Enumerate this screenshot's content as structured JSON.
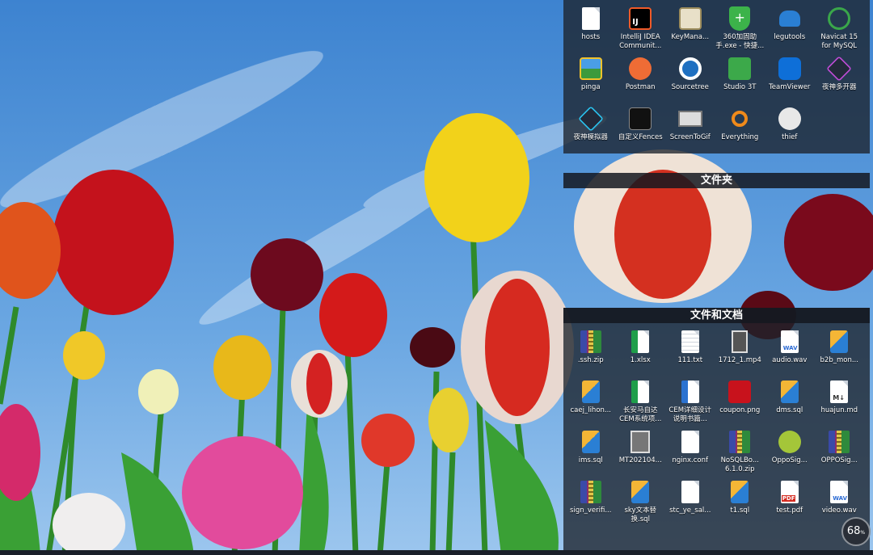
{
  "fences": {
    "apps": {
      "items": [
        {
          "label": "hosts",
          "icon": "file-shortcut-icon"
        },
        {
          "label": "IntelliJ IDEA Communit...",
          "icon": "intellij-idea-icon"
        },
        {
          "label": "KeyMana...",
          "icon": "key-manager-icon"
        },
        {
          "label": "360加固助手.exe - 快捷...",
          "icon": "360-shield-icon"
        },
        {
          "label": "legutools",
          "icon": "legutools-icon"
        },
        {
          "label": "Navicat 15 for MySQL",
          "icon": "navicat-icon"
        },
        {
          "label": "pinga",
          "icon": "image-viewer-icon"
        },
        {
          "label": "Postman",
          "icon": "postman-icon"
        },
        {
          "label": "Sourcetree",
          "icon": "sourcetree-icon"
        },
        {
          "label": "Studio 3T",
          "icon": "studio3t-icon"
        },
        {
          "label": "TeamViewer",
          "icon": "teamviewer-icon"
        },
        {
          "label": "夜神多开器",
          "icon": "nox-multi-icon"
        },
        {
          "label": "夜神模拟器",
          "icon": "nox-emulator-icon"
        },
        {
          "label": "自定义Fences",
          "icon": "fences-icon"
        },
        {
          "label": "ScreenToGif",
          "icon": "screentogif-icon"
        },
        {
          "label": "Everything",
          "icon": "everything-search-icon"
        },
        {
          "label": "thief",
          "icon": "thief-icon"
        }
      ]
    },
    "folders": {
      "title": "文件夹"
    },
    "docs": {
      "title": "文件和文档",
      "items": [
        {
          "label": ".ssh.zip",
          "icon": "zip-archive-icon"
        },
        {
          "label": "1.xlsx",
          "icon": "spreadsheet-icon"
        },
        {
          "label": "111.txt",
          "icon": "text-file-icon"
        },
        {
          "label": "1712_1.mp4",
          "icon": "video-file-icon"
        },
        {
          "label": "audio.wav",
          "icon": "wav-file-icon"
        },
        {
          "label": "b2b_mon...",
          "icon": "sql-file-icon"
        },
        {
          "label": "caej_lihon...",
          "icon": "sql-file-icon"
        },
        {
          "label": "长安马自达CEM系统项...",
          "icon": "spreadsheet-icon"
        },
        {
          "label": "CEM详细设计说明书篇...",
          "icon": "word-doc-icon"
        },
        {
          "label": "coupon.png",
          "icon": "image-file-icon"
        },
        {
          "label": "dms.sql",
          "icon": "sql-file-icon"
        },
        {
          "label": "huajun.md",
          "icon": "markdown-file-icon"
        },
        {
          "label": "ims.sql",
          "icon": "sql-file-icon"
        },
        {
          "label": "MT202104...",
          "icon": "photo-file-icon"
        },
        {
          "label": "nginx.conf",
          "icon": "blank-file-icon"
        },
        {
          "label": "NoSQLBo... 6.1.0.zip",
          "icon": "zip-archive-icon"
        },
        {
          "label": "OppoSig...",
          "icon": "apk-file-icon"
        },
        {
          "label": "OPPOSig...",
          "icon": "zip-archive-icon"
        },
        {
          "label": "sign_verifi...",
          "icon": "zip-archive-icon"
        },
        {
          "label": "sky文本替换.sql",
          "icon": "sql-file-icon"
        },
        {
          "label": "stc_ye_sal...",
          "icon": "blank-file-icon"
        },
        {
          "label": "t1.sql",
          "icon": "sql-file-icon"
        },
        {
          "label": "test.pdf",
          "icon": "pdf-file-icon"
        },
        {
          "label": "video.wav",
          "icon": "wav-file-icon"
        }
      ]
    }
  },
  "tray": {
    "badge_value": "68",
    "badge_unit": "%"
  },
  "colors": {
    "fence_bg": "#1c222c",
    "sky": "#4a8fd6"
  }
}
